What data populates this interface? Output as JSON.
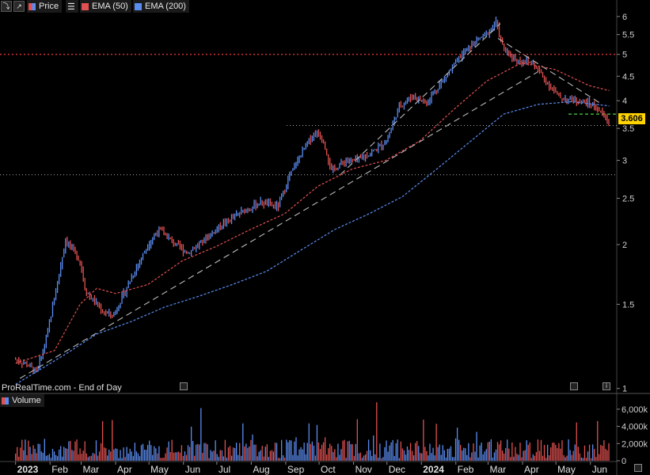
{
  "toolbar": {
    "price_label": "Price",
    "ema50_label": "EMA (50)",
    "ema200_label": "EMA (200)",
    "volume_label": "Volume",
    "source_label": "ProRealTime.com - End of Day",
    "info_icon": "i",
    "calendar_icon": "calendar-icon"
  },
  "colors": {
    "ema50": "#e05050",
    "ema200": "#5a8cf0",
    "up_bar": "#5a8cf0",
    "down_bar": "#e05050",
    "trend": "#bbbbbb",
    "last_badge": "#ffd400"
  },
  "last_price": "3.606",
  "chart_data": {
    "type": "line",
    "scale": "log",
    "ylim": [
      1,
      6.2
    ],
    "y_ticks": [
      "6",
      "5.5",
      "5",
      "4.5",
      "4",
      "3.5",
      "3",
      "2.5",
      "2",
      "1.5",
      "1"
    ],
    "x_labels": [
      "2023",
      "Feb",
      "Mar",
      "Apr",
      "May",
      "Jun",
      "Jul",
      "Aug",
      "Sep",
      "Oct",
      "Nov",
      "Dec",
      "2024",
      "Feb",
      "Mar",
      "Apr",
      "May",
      "Jun"
    ],
    "horizontal_levels": [
      5.0,
      2.8,
      3.55,
      3.75
    ],
    "price_path": [
      {
        "x": "2023-01-01",
        "y": 1.15
      },
      {
        "x": "2023-01-12",
        "y": 1.12
      },
      {
        "x": "2023-01-20",
        "y": 1.08
      },
      {
        "x": "2023-01-28",
        "y": 1.25
      },
      {
        "x": "2023-02-05",
        "y": 1.55
      },
      {
        "x": "2023-02-15",
        "y": 2.05
      },
      {
        "x": "2023-02-28",
        "y": 1.85
      },
      {
        "x": "2023-03-05",
        "y": 1.6
      },
      {
        "x": "2023-03-20",
        "y": 1.45
      },
      {
        "x": "2023-03-30",
        "y": 1.42
      },
      {
        "x": "2023-04-15",
        "y": 1.7
      },
      {
        "x": "2023-04-30",
        "y": 2.0
      },
      {
        "x": "2023-05-10",
        "y": 2.15
      },
      {
        "x": "2023-05-25",
        "y": 2.0
      },
      {
        "x": "2023-06-05",
        "y": 1.92
      },
      {
        "x": "2023-06-20",
        "y": 2.05
      },
      {
        "x": "2023-07-05",
        "y": 2.2
      },
      {
        "x": "2023-07-25",
        "y": 2.35
      },
      {
        "x": "2023-08-10",
        "y": 2.45
      },
      {
        "x": "2023-08-25",
        "y": 2.4
      },
      {
        "x": "2023-09-05",
        "y": 2.8
      },
      {
        "x": "2023-09-20",
        "y": 3.25
      },
      {
        "x": "2023-09-28",
        "y": 3.45
      },
      {
        "x": "2023-10-05",
        "y": 3.3
      },
      {
        "x": "2023-10-12",
        "y": 2.85
      },
      {
        "x": "2023-10-25",
        "y": 3.0
      },
      {
        "x": "2023-11-05",
        "y": 3.0
      },
      {
        "x": "2023-11-20",
        "y": 3.15
      },
      {
        "x": "2023-12-01",
        "y": 3.3
      },
      {
        "x": "2023-12-12",
        "y": 3.9
      },
      {
        "x": "2023-12-25",
        "y": 4.1
      },
      {
        "x": "2024-01-05",
        "y": 3.95
      },
      {
        "x": "2024-01-20",
        "y": 4.4
      },
      {
        "x": "2024-02-05",
        "y": 4.95
      },
      {
        "x": "2024-02-20",
        "y": 5.35
      },
      {
        "x": "2024-03-01",
        "y": 5.55
      },
      {
        "x": "2024-03-08",
        "y": 5.85
      },
      {
        "x": "2024-03-15",
        "y": 5.1
      },
      {
        "x": "2024-03-28",
        "y": 4.85
      },
      {
        "x": "2024-04-10",
        "y": 4.8
      },
      {
        "x": "2024-04-22",
        "y": 4.4
      },
      {
        "x": "2024-05-05",
        "y": 4.05
      },
      {
        "x": "2024-05-20",
        "y": 4.0
      },
      {
        "x": "2024-05-31",
        "y": 3.95
      },
      {
        "x": "2024-06-10",
        "y": 3.8
      },
      {
        "x": "2024-06-18",
        "y": 3.606
      }
    ],
    "series": [
      {
        "name": "EMA (50)",
        "values": [
          {
            "x": "2023-01-01",
            "y": 1.13
          },
          {
            "x": "2023-02-05",
            "y": 1.2
          },
          {
            "x": "2023-02-28",
            "y": 1.5
          },
          {
            "x": "2023-03-15",
            "y": 1.62
          },
          {
            "x": "2023-04-01",
            "y": 1.58
          },
          {
            "x": "2023-04-30",
            "y": 1.65
          },
          {
            "x": "2023-05-31",
            "y": 1.85
          },
          {
            "x": "2023-06-30",
            "y": 1.98
          },
          {
            "x": "2023-07-31",
            "y": 2.15
          },
          {
            "x": "2023-08-31",
            "y": 2.32
          },
          {
            "x": "2023-09-30",
            "y": 2.65
          },
          {
            "x": "2023-10-31",
            "y": 2.88
          },
          {
            "x": "2023-11-30",
            "y": 3.0
          },
          {
            "x": "2023-12-31",
            "y": 3.3
          },
          {
            "x": "2024-01-31",
            "y": 3.85
          },
          {
            "x": "2024-02-29",
            "y": 4.4
          },
          {
            "x": "2024-03-31",
            "y": 4.8
          },
          {
            "x": "2024-04-30",
            "y": 4.65
          },
          {
            "x": "2024-05-31",
            "y": 4.3
          },
          {
            "x": "2024-06-18",
            "y": 4.2
          }
        ]
      },
      {
        "name": "EMA (200)",
        "values": [
          {
            "x": "2023-01-01",
            "y": 1.02
          },
          {
            "x": "2023-02-15",
            "y": 1.18
          },
          {
            "x": "2023-03-15",
            "y": 1.3
          },
          {
            "x": "2023-04-15",
            "y": 1.38
          },
          {
            "x": "2023-05-15",
            "y": 1.48
          },
          {
            "x": "2023-06-15",
            "y": 1.56
          },
          {
            "x": "2023-07-15",
            "y": 1.65
          },
          {
            "x": "2023-08-15",
            "y": 1.76
          },
          {
            "x": "2023-09-15",
            "y": 1.95
          },
          {
            "x": "2023-10-15",
            "y": 2.15
          },
          {
            "x": "2023-11-15",
            "y": 2.32
          },
          {
            "x": "2023-12-15",
            "y": 2.52
          },
          {
            "x": "2024-01-15",
            "y": 2.88
          },
          {
            "x": "2024-02-15",
            "y": 3.3
          },
          {
            "x": "2024-03-15",
            "y": 3.75
          },
          {
            "x": "2024-04-15",
            "y": 3.93
          },
          {
            "x": "2024-05-15",
            "y": 3.98
          },
          {
            "x": "2024-06-18",
            "y": 3.9
          }
        ]
      }
    ],
    "trendlines": [
      {
        "from": {
          "x": "2023-01-05",
          "y": 1.05
        },
        "to": {
          "x": "2024-04-15",
          "y": 4.6
        }
      },
      {
        "from": {
          "x": "2023-10-20",
          "y": 2.8
        },
        "to": {
          "x": "2024-03-12",
          "y": 5.8
        }
      },
      {
        "from": {
          "x": "2024-03-10",
          "y": 5.4
        },
        "to": {
          "x": "2024-06-10",
          "y": 3.95
        }
      }
    ],
    "volume": {
      "y_ticks": [
        "6,000k",
        "4,000k",
        "2,000k",
        "0"
      ],
      "ylim": [
        0,
        7000
      ],
      "unit": "k"
    }
  }
}
